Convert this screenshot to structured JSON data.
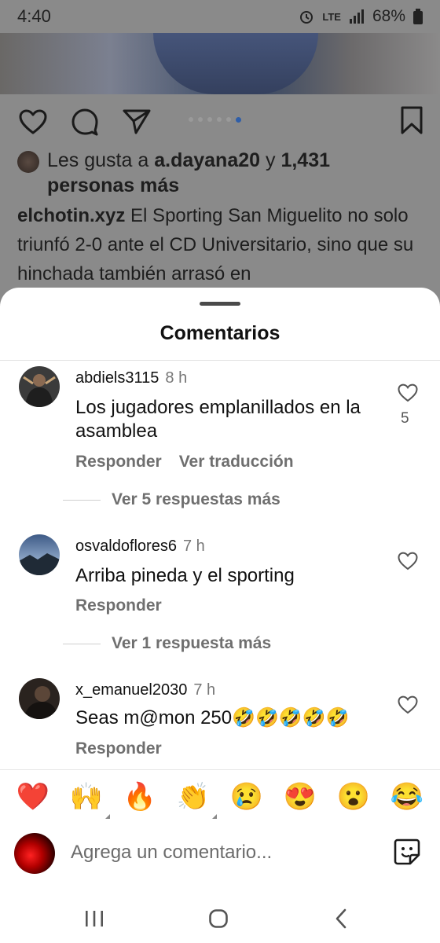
{
  "status_bar": {
    "time": "4:40",
    "network": "LTE",
    "battery": "68%"
  },
  "post": {
    "likes": {
      "prefix": "Les gusta a",
      "user": "a.dayana20",
      "connector": "y",
      "count": "1,431",
      "suffix": "personas más"
    },
    "caption": {
      "user": "elchotin.xyz",
      "text": "El Sporting San Miguelito no solo triunfó 2-0 ante el CD Universitario, sino que su hinchada también arrasó en"
    },
    "carousel": {
      "total": 6,
      "active_index": 5
    }
  },
  "sheet": {
    "title": "Comentarios"
  },
  "comments": [
    {
      "username": "abdiels3115",
      "time": "8 h",
      "text": "Los jugadores emplanillados en la asamblea",
      "reply_label": "Responder",
      "translate_label": "Ver traducción",
      "likes": "5",
      "replies_label": "Ver 5 respuestas más"
    },
    {
      "username": "osvaldoflores6",
      "time": "7 h",
      "text": "Arriba pineda y el sporting",
      "reply_label": "Responder",
      "replies_label": "Ver 1 respuesta más"
    },
    {
      "username": "x_emanuel2030",
      "time": "7 h",
      "text": "Seas m@mon 250🤣🤣🤣🤣🤣",
      "reply_label": "Responder"
    }
  ],
  "emojis": [
    "❤️",
    "🙌",
    "🔥",
    "👏",
    "😢",
    "😍",
    "😮",
    "😂"
  ],
  "composer": {
    "placeholder": "Agrega un comentario..."
  },
  "icons": {
    "heart": "heart-icon",
    "comment": "comment-icon",
    "share": "send-icon",
    "bookmark": "bookmark-icon",
    "sticker": "sticker-icon"
  },
  "colors": {
    "accent_dot": "#2f5ea8",
    "sheet_bg": "#ffffff",
    "muted_text": "#6f6f6f"
  }
}
